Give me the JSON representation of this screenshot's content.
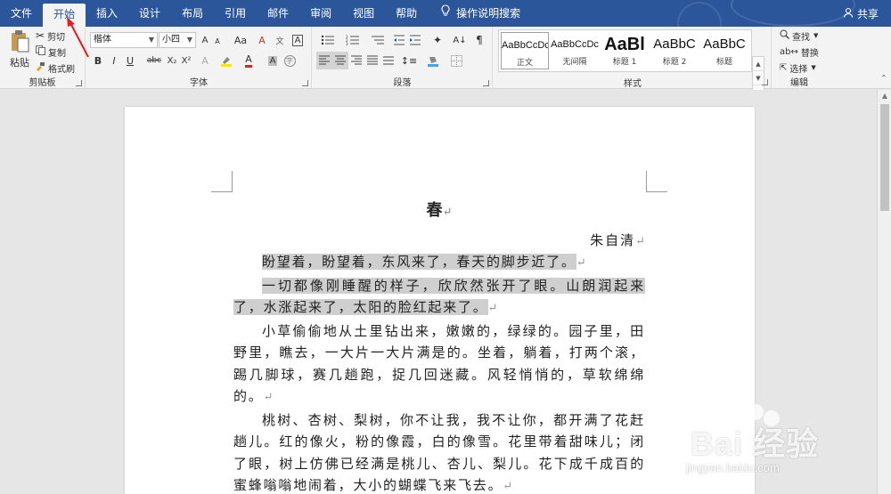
{
  "tabs": [
    {
      "label": "文件"
    },
    {
      "label": "开始"
    },
    {
      "label": "插入"
    },
    {
      "label": "设计"
    },
    {
      "label": "布局"
    },
    {
      "label": "引用"
    },
    {
      "label": "邮件"
    },
    {
      "label": "审阅"
    },
    {
      "label": "视图"
    },
    {
      "label": "帮助"
    }
  ],
  "tell_me": "操作说明搜索",
  "share_label": "共享",
  "clipboard": {
    "paste": "粘贴",
    "cut": "剪切",
    "copy": "复制",
    "format_painter": "格式刷",
    "group_label": "剪贴板"
  },
  "font": {
    "name": "楷体",
    "size": "小四",
    "grow": "A",
    "shrink": "A",
    "case": "Aa",
    "bold": "B",
    "italic": "I",
    "underline": "U",
    "strike": "abc",
    "subscript": "X₂",
    "superscript": "X²",
    "group_label": "字体"
  },
  "paragraph": {
    "group_label": "段落"
  },
  "styles": {
    "items": [
      {
        "sample": "AaBbCcDc",
        "name": "正文"
      },
      {
        "sample": "AaBbCcDc",
        "name": "无间隔"
      },
      {
        "sample": "AaBl",
        "name": "标题 1"
      },
      {
        "sample": "AaBbC",
        "name": "标题 2"
      },
      {
        "sample": "AaBbC",
        "name": "标题"
      }
    ],
    "group_label": "样式"
  },
  "editing": {
    "find": "查找",
    "replace": "替换",
    "select": "选择",
    "group_label": "编辑"
  },
  "document": {
    "title": "春",
    "author": "朱自清",
    "paragraphs": [
      {
        "text": "盼望着，盼望着，东风来了，春天的脚步近了。",
        "highlight": true
      },
      {
        "text": "一切都像刚睡醒的样子，欣欣然张开了眼。山朗润起来了，水涨起来了，太阳的脸红起来了。",
        "highlight": true
      },
      {
        "text": "小草偷偷地从土里钻出来，嫩嫩的，绿绿的。园子里，田野里，瞧去，一大片一大片满是的。坐着，躺着，打两个滚，踢几脚球，赛几趟跑，捉几回迷藏。风轻悄悄的，草软绵绵的。",
        "highlight": false
      },
      {
        "text": "桃树、杏树、梨树，你不让我，我不让你，都开满了花赶趟儿。红的像火，粉的像霞，白的像雪。花里带着甜味儿；闭了眼，树上仿佛已经满是桃儿、杏儿、梨儿。花下成千成百的蜜蜂嗡嗡地闹着，大小的蝴蝶飞来飞去。",
        "highlight": false
      }
    ],
    "mark": "↵"
  },
  "watermark": {
    "main": "Bai 经验",
    "sub": "jingyan.baidu.com"
  },
  "colors": {
    "accent": "#2b579a",
    "ribbon": "#f3f3f3",
    "highlight": "#cfcfcf",
    "arrow": "#e02020"
  }
}
